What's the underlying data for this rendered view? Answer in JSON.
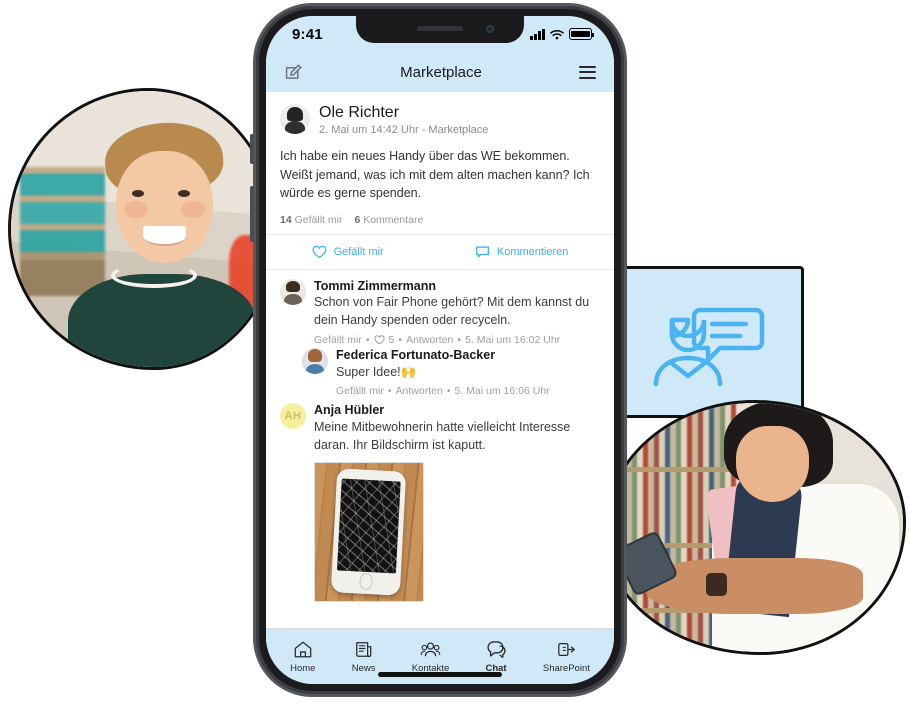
{
  "phone": {
    "status": {
      "time": "9:41",
      "signal_icon": "cellular-signal-icon",
      "wifi_icon": "wifi-icon",
      "battery_icon": "battery-icon"
    },
    "header": {
      "title": "Marketplace",
      "compose_icon": "compose-edit-icon",
      "menu_icon": "hamburger-menu-icon"
    },
    "post": {
      "author": "Ole Richter",
      "meta": "2. Mai um 14:42 Uhr - Marketplace",
      "body": "Ich habe ein neues Handy über das WE bekommen. Weißt jemand, was ich mit dem alten machen kann? Ich würde es gerne spenden.",
      "like_count": "14",
      "like_count_label": "Gefällt mir",
      "comment_count": "6",
      "comment_count_label": "Kommentare",
      "actions": [
        {
          "label": "Gefällt mir",
          "icon": "heart-icon"
        },
        {
          "label": "Kommentieren",
          "icon": "comment-bubble-icon"
        }
      ]
    },
    "comments": [
      {
        "author": "Tommi Zimmermann",
        "text": "Schon von Fair Phone gehört? Mit dem kannst du dein Handy spenden oder recyceln.",
        "like_label": "Gefällt mir",
        "heart_count": "5",
        "reply_label": "Antworten",
        "time": "5. Mai um 16:02 Uhr"
      },
      {
        "author": "Federica Fortunato-Backer",
        "text": "Super Idee!",
        "emoji": "🙌",
        "like_label": "Gefällt mir",
        "reply_label": "Antworten",
        "time": "5. Mai um 16:06 Uhr"
      },
      {
        "author": "Anja Hübler",
        "initials": "AH",
        "text": "Meine Mitbewohnerin hatte vielleicht Interesse daran. Ihr Bildschirm ist kaputt.",
        "attachment": "broken-phone-photo"
      }
    ],
    "tabs": [
      {
        "label": "Home",
        "icon": "home-icon",
        "active": false
      },
      {
        "label": "News",
        "icon": "news-icon",
        "active": false
      },
      {
        "label": "Kontakte",
        "icon": "contacts-icon",
        "active": false
      },
      {
        "label": "Chat",
        "icon": "chat-icon",
        "active": true
      },
      {
        "label": "SharePoint",
        "icon": "sharepoint-icon",
        "active": false
      }
    ]
  },
  "decor": {
    "left_photo": "portrait-smiling-man",
    "illustration_card": "person-with-speech-bubble-illustration",
    "right_photo": "two-people-looking-at-phone"
  },
  "colors": {
    "accent": "#3aaeef",
    "app_chrome": "#cfe9f9",
    "text": "#1a1a1a",
    "muted": "#9a9a9a",
    "initials_bg": "#f7ef9c"
  }
}
